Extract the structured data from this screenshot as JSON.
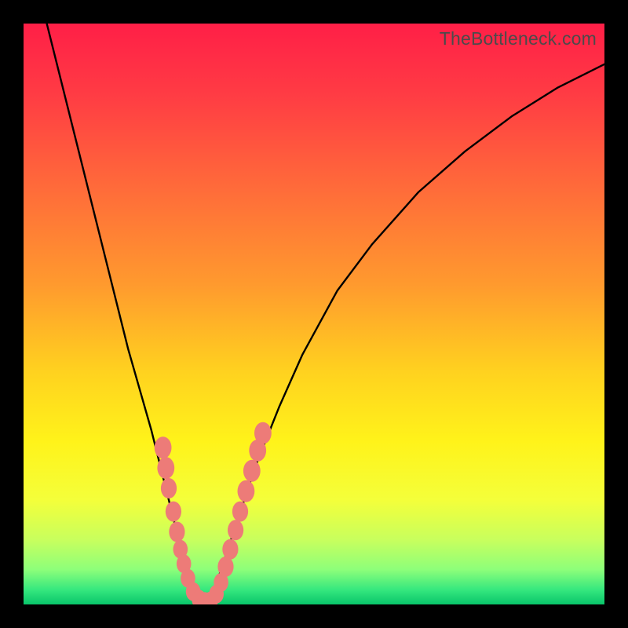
{
  "watermark": "TheBottleneck.com",
  "colors": {
    "frame": "#000000",
    "curve_stroke": "#000000",
    "marker_fill": "#ed7b78",
    "gradient_stops": [
      {
        "offset": 0.0,
        "color": "#ff1f47"
      },
      {
        "offset": 0.12,
        "color": "#ff3b44"
      },
      {
        "offset": 0.28,
        "color": "#ff6a3a"
      },
      {
        "offset": 0.45,
        "color": "#ff9a2e"
      },
      {
        "offset": 0.6,
        "color": "#ffd21f"
      },
      {
        "offset": 0.72,
        "color": "#fff31a"
      },
      {
        "offset": 0.82,
        "color": "#f4ff3a"
      },
      {
        "offset": 0.89,
        "color": "#c7ff5e"
      },
      {
        "offset": 0.94,
        "color": "#8dff7a"
      },
      {
        "offset": 0.975,
        "color": "#35e77e"
      },
      {
        "offset": 1.0,
        "color": "#09c56a"
      }
    ]
  },
  "chart_data": {
    "type": "line",
    "title": "",
    "xlabel": "",
    "ylabel": "",
    "xlim": [
      0,
      100
    ],
    "ylim": [
      0,
      100
    ],
    "grid": false,
    "series": [
      {
        "name": "bottleneck-curve",
        "x": [
          4,
          6,
          8,
          10,
          12,
          14,
          16,
          18,
          20,
          22,
          24,
          25,
          26,
          27,
          28,
          29,
          30,
          31,
          32,
          33,
          34,
          36,
          38,
          40,
          44,
          48,
          54,
          60,
          68,
          76,
          84,
          92,
          100
        ],
        "y": [
          100,
          92,
          84,
          76,
          68,
          60,
          52,
          44,
          37,
          30,
          22,
          18,
          14,
          10,
          6,
          3,
          1,
          0.5,
          1,
          3,
          6,
          12,
          18,
          24,
          34,
          43,
          54,
          62,
          71,
          78,
          84,
          89,
          93
        ]
      }
    ],
    "markers": [
      {
        "x": 24.0,
        "y": 27.0,
        "r": 1.4
      },
      {
        "x": 24.5,
        "y": 23.5,
        "r": 1.4
      },
      {
        "x": 25.0,
        "y": 20.0,
        "r": 1.3
      },
      {
        "x": 25.8,
        "y": 16.0,
        "r": 1.3
      },
      {
        "x": 26.4,
        "y": 12.5,
        "r": 1.3
      },
      {
        "x": 27.0,
        "y": 9.5,
        "r": 1.2
      },
      {
        "x": 27.6,
        "y": 7.0,
        "r": 1.2
      },
      {
        "x": 28.3,
        "y": 4.5,
        "r": 1.2
      },
      {
        "x": 29.2,
        "y": 2.2,
        "r": 1.2
      },
      {
        "x": 30.2,
        "y": 0.9,
        "r": 1.2
      },
      {
        "x": 31.2,
        "y": 0.5,
        "r": 1.2
      },
      {
        "x": 32.2,
        "y": 0.6,
        "r": 1.2
      },
      {
        "x": 33.2,
        "y": 1.8,
        "r": 1.2
      },
      {
        "x": 34.0,
        "y": 3.8,
        "r": 1.2
      },
      {
        "x": 34.8,
        "y": 6.5,
        "r": 1.3
      },
      {
        "x": 35.6,
        "y": 9.5,
        "r": 1.3
      },
      {
        "x": 36.5,
        "y": 12.8,
        "r": 1.3
      },
      {
        "x": 37.3,
        "y": 16.0,
        "r": 1.3
      },
      {
        "x": 38.3,
        "y": 19.5,
        "r": 1.4
      },
      {
        "x": 39.3,
        "y": 23.0,
        "r": 1.4
      },
      {
        "x": 40.3,
        "y": 26.5,
        "r": 1.4
      },
      {
        "x": 41.2,
        "y": 29.5,
        "r": 1.4
      }
    ]
  }
}
